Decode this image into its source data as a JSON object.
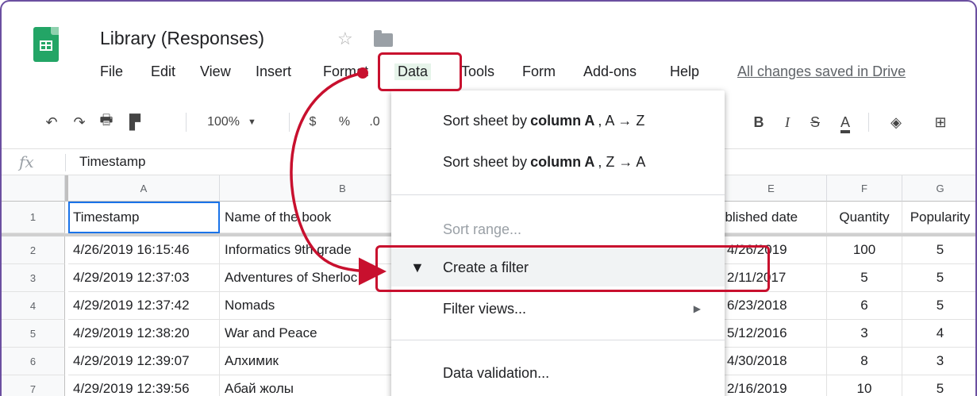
{
  "header": {
    "doc_title": "Library (Responses)",
    "star_icon": "star-outline-icon",
    "folder_icon": "folder-icon",
    "saved_status": "All changes saved in Drive"
  },
  "menu": {
    "file": "File",
    "edit": "Edit",
    "view": "View",
    "insert": "Insert",
    "format": "Format",
    "data": "Data",
    "tools": "Tools",
    "form": "Form",
    "addons": "Add-ons",
    "help": "Help"
  },
  "toolbar": {
    "zoom": "100%",
    "currency": "$",
    "percent": "%",
    "decimal": ".0",
    "bold": "B",
    "italic": "I",
    "strike": "S",
    "text_color": "A"
  },
  "formula_bar": {
    "fx_label": "fx",
    "value": "Timestamp"
  },
  "grid": {
    "columns": [
      "A",
      "B",
      "E",
      "F",
      "G"
    ],
    "row_numbers": [
      "1",
      "2",
      "3",
      "4",
      "5",
      "6",
      "7"
    ],
    "header_row": {
      "a": "Timestamp",
      "b": "Name of the book",
      "e": "ublished date",
      "f": "Quantity",
      "g": "Popularity"
    },
    "rows": [
      {
        "a": "4/26/2019 16:15:46",
        "b": "Informatics 9th grade",
        "e": "4/26/2019",
        "f": "100",
        "g": "5"
      },
      {
        "a": "4/29/2019 12:37:03",
        "b": "Adventures of Sherloc",
        "e": "2/11/2017",
        "f": "5",
        "g": "5"
      },
      {
        "a": "4/29/2019 12:37:42",
        "b": "Nomads",
        "e": "6/23/2018",
        "f": "6",
        "g": "5"
      },
      {
        "a": "4/29/2019 12:38:20",
        "b": "War and Peace",
        "e": "5/12/2016",
        "f": "3",
        "g": "4"
      },
      {
        "a": "4/29/2019 12:39:07",
        "b": "Алхимик",
        "e": "4/30/2018",
        "f": "8",
        "g": "3"
      },
      {
        "a": "4/29/2019 12:39:56",
        "b": "Абай жолы",
        "e": "2/16/2019",
        "f": "10",
        "g": "5"
      }
    ]
  },
  "data_menu": {
    "sort_az_prefix": "Sort sheet by",
    "sort_az_col": "column A",
    "sort_az_suffix": ", A → Z",
    "sort_za_prefix": "Sort sheet by",
    "sort_za_col": "column A",
    "sort_za_suffix": ", Z → A",
    "sort_range": "Sort range...",
    "create_filter": "Create a filter",
    "filter_views": "Filter views...",
    "data_validation": "Data validation..."
  },
  "colors": {
    "annotation": "#c8102e",
    "sheets_green": "#23a566",
    "active_menu_bg": "#e6f4ea"
  }
}
